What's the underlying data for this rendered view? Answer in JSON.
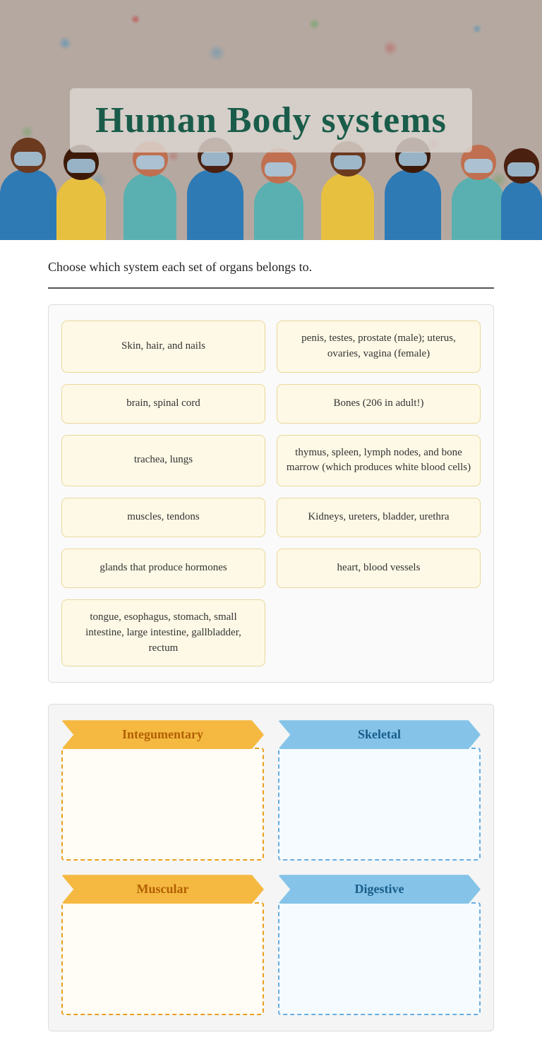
{
  "hero": {
    "title": "Human Body systems"
  },
  "page": {
    "instruction": "Choose which system each set of organs belongs to."
  },
  "drag_items": [
    {
      "id": "item-1",
      "text": "Skin, hair, and nails"
    },
    {
      "id": "item-2",
      "text": "penis, testes, prostate (male); uterus, ovaries, vagina (female)"
    },
    {
      "id": "item-3",
      "text": "brain, spinal cord"
    },
    {
      "id": "item-4",
      "text": "Bones (206 in adult!)"
    },
    {
      "id": "item-5",
      "text": "trachea, lungs"
    },
    {
      "id": "item-6",
      "text": "thymus, spleen, lymph nodes, and bone marrow (which produces white blood cells)"
    },
    {
      "id": "item-7",
      "text": "muscles, tendons"
    },
    {
      "id": "item-8",
      "text": "Kidneys, ureters, bladder, urethra"
    },
    {
      "id": "item-9",
      "text": "glands that produce hormones"
    },
    {
      "id": "item-10",
      "text": "heart, blood vessels"
    },
    {
      "id": "item-11",
      "text": "tongue, esophagus, stomach, small intestine, large intestine, gallbladder, rectum"
    }
  ],
  "drop_zones": [
    {
      "id": "zone-integumentary",
      "label": "Integumentary",
      "style": "orange"
    },
    {
      "id": "zone-skeletal",
      "label": "Skeletal",
      "style": "blue"
    },
    {
      "id": "zone-muscular",
      "label": "Muscular",
      "style": "orange"
    },
    {
      "id": "zone-digestive",
      "label": "Digestive",
      "style": "blue"
    }
  ]
}
